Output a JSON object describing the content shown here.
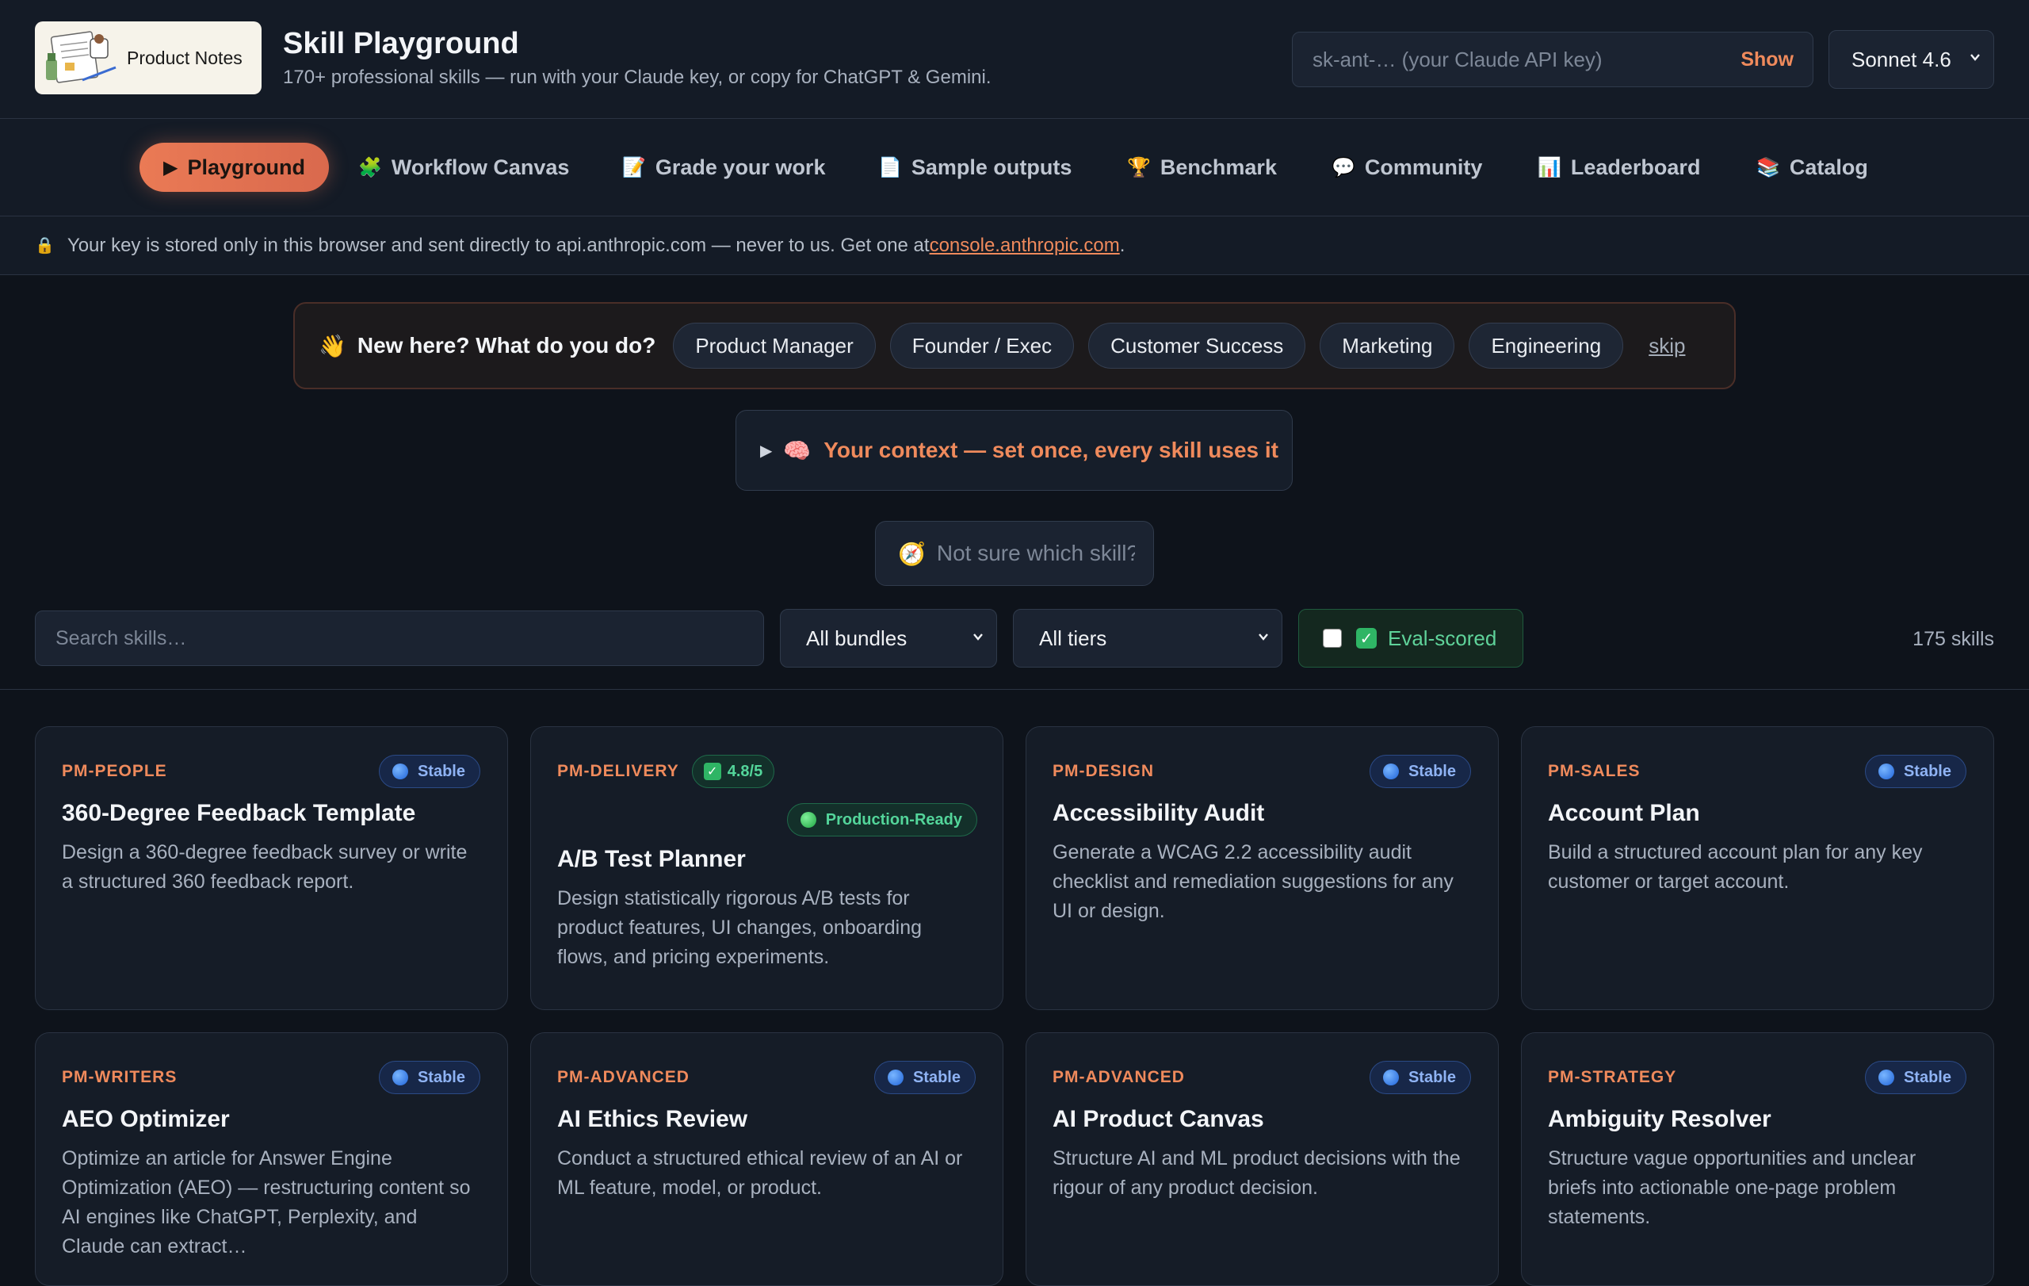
{
  "header": {
    "logo_text": "Product Notes",
    "title": "Skill Playground",
    "subtitle": "170+ professional skills — run with your Claude key, or copy for ChatGPT & Gemini.",
    "api_key_placeholder": "sk-ant-… (your Claude API key)",
    "show_label": "Show",
    "model_selected": "Sonnet 4.6"
  },
  "nav": {
    "items": [
      {
        "icon": "▶",
        "label": "Playground",
        "active": true
      },
      {
        "icon": "🧩",
        "label": "Workflow Canvas"
      },
      {
        "icon": "📝",
        "label": "Grade your work"
      },
      {
        "icon": "📄",
        "label": "Sample outputs"
      },
      {
        "icon": "🏆",
        "label": "Benchmark"
      },
      {
        "icon": "💬",
        "label": "Community"
      },
      {
        "icon": "📊",
        "label": "Leaderboard"
      },
      {
        "icon": "📚",
        "label": "Catalog"
      }
    ]
  },
  "notice": {
    "lock_icon": "🔒",
    "text": "Your key is stored only in this browser and sent directly to api.anthropic.com — never to us. Get one at ",
    "link": "console.anthropic.com",
    "trail": "."
  },
  "onboarding": {
    "wave_icon": "👋",
    "question": "New here? What do you do?",
    "roles": [
      "Product Manager",
      "Founder / Exec",
      "Customer Success",
      "Marketing",
      "Engineering"
    ],
    "skip": "skip"
  },
  "context": {
    "tri": "▶",
    "brain_icon": "🧠",
    "label": "Your context — set once, every skill uses it"
  },
  "finder": {
    "compass_icon": "🧭",
    "placeholder": "Not sure which skill?"
  },
  "filters": {
    "search_placeholder": "Search skills…",
    "bundle_selected": "All bundles",
    "tier_selected": "All tiers",
    "eval_label": "Eval-scored",
    "eval_check": "✓",
    "count": "175 skills"
  },
  "cards": [
    {
      "bundle": "PM-PEOPLE",
      "badge": "Stable",
      "title": "360-Degree Feedback Template",
      "desc": "Design a 360-degree feedback survey or write a structured 360 feedback report."
    },
    {
      "bundle": "PM-DELIVERY",
      "score": "4.8/5",
      "badge": "Production-Ready",
      "title": "A/B Test Planner",
      "desc": "Design statistically rigorous A/B tests for product features, UI changes, onboarding flows, and pricing experiments."
    },
    {
      "bundle": "PM-DESIGN",
      "badge": "Stable",
      "title": "Accessibility Audit",
      "desc": "Generate a WCAG 2.2 accessibility audit checklist and remediation suggestions for any UI or design."
    },
    {
      "bundle": "PM-SALES",
      "badge": "Stable",
      "title": "Account Plan",
      "desc": "Build a structured account plan for any key customer or target account."
    },
    {
      "bundle": "PM-WRITERS",
      "badge": "Stable",
      "title": "AEO Optimizer",
      "desc": "Optimize an article for Answer Engine Optimization (AEO) — restructuring content so AI engines like ChatGPT, Perplexity, and Claude can extract…"
    },
    {
      "bundle": "PM-ADVANCED",
      "badge": "Stable",
      "title": "AI Ethics Review",
      "desc": "Conduct a structured ethical review of an AI or ML feature, model, or product."
    },
    {
      "bundle": "PM-ADVANCED",
      "badge": "Stable",
      "title": "AI Product Canvas",
      "desc": "Structure AI and ML product decisions with the rigour of any product decision."
    },
    {
      "bundle": "PM-STRATEGY",
      "badge": "Stable",
      "title": "Ambiguity Resolver",
      "desc": "Structure vague opportunities and unclear briefs into actionable one-page problem statements."
    }
  ]
}
